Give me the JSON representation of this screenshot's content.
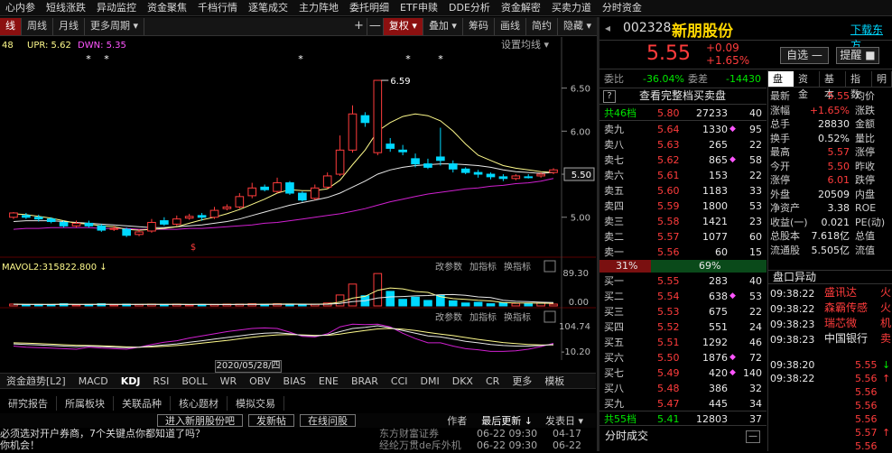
{
  "top_nav": [
    "心内参",
    "短线涨跌",
    "异动监控",
    "资金聚焦",
    "千档行情",
    "逐笔成交",
    "主力阵地",
    "委托明细",
    "ETF申赎",
    "DDE分析",
    "资金解密",
    "买卖力道",
    "分时资金"
  ],
  "toolbar": {
    "left": [
      "线",
      "周线",
      "月线",
      "更多周期 ▾"
    ],
    "icons": [
      "+",
      "—"
    ],
    "right": [
      "复权 ▾",
      "叠加 ▾",
      "筹码",
      "画线",
      "简约",
      "隐藏 ▾"
    ]
  },
  "legend": {
    "ma_value": "48",
    "upr": "UPR: 5.62",
    "dwn": "DWN: 5.35",
    "settings": "设置均线 ▾"
  },
  "price_axis": [
    "6.50",
    "6.00",
    "5.50",
    "5.00"
  ],
  "current_price_tag": "5.50",
  "annotations": {
    "high_label": "6.59",
    "dollar": "$",
    "stars": [
      "*",
      "*",
      "*",
      "*",
      "*"
    ]
  },
  "volume_panel": {
    "legend": "MAVOL2:315822.800 ↓",
    "buttons": [
      "改参数",
      "加指标",
      "换指标"
    ],
    "axis": [
      "89.30",
      "0.00"
    ]
  },
  "kdj_panel": {
    "buttons": [
      "改参数",
      "加指标",
      "换指标"
    ],
    "axis": [
      "104.74",
      "-10.20"
    ]
  },
  "date_label": "2020/05/28/四",
  "indicator_tabs": [
    "资金趋势[L2]",
    "MACD",
    "KDJ",
    "RSI",
    "BOLL",
    "WR",
    "OBV",
    "BIAS",
    "ENE",
    "BRAR",
    "CCI",
    "DMI",
    "DKX",
    "CR",
    "更多",
    "模板"
  ],
  "active_indicator": "KDJ",
  "info_tabs": [
    "研究报告",
    "所属板块",
    "关联品种",
    "核心题材",
    "模拟交易"
  ],
  "news_bar": {
    "buttons": [
      "进入新朋股份吧",
      "发新帖",
      "在线问股"
    ],
    "author": "作者",
    "latest": "最后更新 ↓",
    "posted": "发表日 ▾"
  },
  "news_items": [
    {
      "title": "必须选对开户券商，7个关键点你都知道了吗？",
      "source": "东方财富证券",
      "update": "06-22 09:30",
      "date": "04-17"
    },
    {
      "title": "你机会！",
      "source": "经纶万贯de斥外机",
      "update": "06-22 09:30",
      "date": "06-22"
    }
  ],
  "quote": {
    "code": "002328",
    "name": "新朋股份",
    "download": "下载东方",
    "price": "5.55",
    "change": "+0.09",
    "pct": "+1.65%",
    "add_self": "自选 —",
    "remind": "提醒 ■",
    "weibi_label": "委比",
    "weibi": "-36.04%",
    "weicha_label": "委差",
    "weicha": "-14430",
    "view_full": "查看完整档买卖盘",
    "total_sell_label": "共46档",
    "total_sell_price": "5.80",
    "total_sell_vol": "27233",
    "total_sell_cnt": "40",
    "total_buy_label": "共55档",
    "total_buy_price": "5.41",
    "total_buy_vol": "12803",
    "total_buy_cnt": "37",
    "ratio_sell": "31%",
    "ratio_buy": "69%",
    "tick_title": "分时成交"
  },
  "asks": [
    {
      "label": "卖九",
      "price": "5.64",
      "vol": "1330",
      "mark": "◆",
      "cnt": "95"
    },
    {
      "label": "卖八",
      "price": "5.63",
      "vol": "265",
      "mark": "",
      "cnt": "22"
    },
    {
      "label": "卖七",
      "price": "5.62",
      "vol": "865",
      "mark": "◆",
      "cnt": "58"
    },
    {
      "label": "卖六",
      "price": "5.61",
      "vol": "153",
      "mark": "",
      "cnt": "22"
    },
    {
      "label": "卖五",
      "price": "5.60",
      "vol": "1183",
      "mark": "",
      "cnt": "33"
    },
    {
      "label": "卖四",
      "price": "5.59",
      "vol": "1800",
      "mark": "",
      "cnt": "53"
    },
    {
      "label": "卖三",
      "price": "5.58",
      "vol": "1421",
      "mark": "",
      "cnt": "23"
    },
    {
      "label": "卖二",
      "price": "5.57",
      "vol": "1077",
      "mark": "",
      "cnt": "60"
    },
    {
      "label": "卖一",
      "price": "5.56",
      "vol": "60",
      "mark": "",
      "cnt": "15"
    }
  ],
  "bids": [
    {
      "label": "买一",
      "price": "5.55",
      "vol": "283",
      "mark": "",
      "cnt": "40"
    },
    {
      "label": "买二",
      "price": "5.54",
      "vol": "638",
      "mark": "◆",
      "cnt": "53"
    },
    {
      "label": "买三",
      "price": "5.53",
      "vol": "675",
      "mark": "",
      "cnt": "22"
    },
    {
      "label": "买四",
      "price": "5.52",
      "vol": "551",
      "mark": "",
      "cnt": "24"
    },
    {
      "label": "买五",
      "price": "5.51",
      "vol": "1292",
      "mark": "",
      "cnt": "46"
    },
    {
      "label": "买六",
      "price": "5.50",
      "vol": "1876",
      "mark": "◆",
      "cnt": "72"
    },
    {
      "label": "买七",
      "price": "5.49",
      "vol": "420",
      "mark": "◆",
      "cnt": "140"
    },
    {
      "label": "买八",
      "price": "5.48",
      "vol": "386",
      "mark": "",
      "cnt": "32"
    },
    {
      "label": "买九",
      "price": "5.47",
      "vol": "445",
      "mark": "",
      "cnt": "34"
    }
  ],
  "side_tabs": [
    "盘口",
    "资金",
    "基本",
    "指数",
    "明"
  ],
  "stats": [
    {
      "l": "最新",
      "v": "5.55",
      "l2": "均价"
    },
    {
      "l": "涨幅",
      "v": "+1.65%",
      "l2": "涨跌"
    },
    {
      "l": "总手",
      "v": "28830",
      "l2": "金额"
    },
    {
      "l": "换手",
      "v": "0.52%",
      "l2": "量比"
    },
    {
      "l": "最高",
      "v": "5.57",
      "l2": "涨停"
    },
    {
      "l": "今开",
      "v": "5.50",
      "l2": "昨收"
    },
    {
      "l": "涨停",
      "v": "6.01",
      "l2": "跌停"
    },
    {
      "l": "外盘",
      "v": "20509",
      "l2": "内盘"
    },
    {
      "l": "净资产",
      "v": "3.38",
      "l2": "ROE"
    },
    {
      "l": "收益(一)",
      "v": "0.021",
      "l2": "PE(动)"
    },
    {
      "l": "总股本",
      "v": "7.618亿",
      "l2": "总值"
    },
    {
      "l": "流通股",
      "v": "5.505亿",
      "l2": "流值"
    }
  ],
  "abnormal_title": "盘口异动",
  "abnormal": [
    {
      "time": "09:38:22",
      "name": "盛讯达",
      "tag": "火"
    },
    {
      "time": "09:38:22",
      "name": "森霸传感",
      "tag": "火"
    },
    {
      "time": "09:38:23",
      "name": "瑞芯微",
      "tag": "机"
    },
    {
      "time": "09:38:23",
      "name": "中国银行",
      "tag": "卖"
    }
  ],
  "ticks": [
    {
      "time": "09:38:20",
      "price": "5.55",
      "arrow": "↓"
    },
    {
      "time": "09:38:22",
      "price": "5.56",
      "arrow": "↑"
    },
    {
      "time": "",
      "price": "5.56",
      "arrow": ""
    },
    {
      "time": "",
      "price": "5.56",
      "arrow": ""
    },
    {
      "time": "",
      "price": "5.56",
      "arrow": ""
    },
    {
      "time": "",
      "price": "5.57",
      "arrow": "↑"
    },
    {
      "time": "",
      "price": "5.56",
      "arrow": ""
    }
  ],
  "colors": {
    "up": "#ff3c3c",
    "down": "#00d8ff",
    "ma5": "#fffb8c",
    "ma10": "#e8e8e8",
    "ma20": "#d020d0",
    "bg": "#000000"
  },
  "chart_data": {
    "type": "candlestick",
    "y_axis_ticks": [
      6.5,
      6.0,
      5.5,
      5.0
    ],
    "candles": [
      [
        5.0,
        5.05,
        5.06,
        4.98
      ],
      [
        5.02,
        5.0,
        5.05,
        4.98
      ],
      [
        5.0,
        4.98,
        5.03,
        4.95
      ],
      [
        4.98,
        4.95,
        5.0,
        4.93
      ],
      [
        4.94,
        4.9,
        4.96,
        4.88
      ],
      [
        4.9,
        4.93,
        4.96,
        4.88
      ],
      [
        4.93,
        4.9,
        4.96,
        4.88
      ],
      [
        4.9,
        4.85,
        4.92,
        4.83
      ],
      [
        4.86,
        4.87,
        4.9,
        4.84
      ],
      [
        4.86,
        4.79,
        4.88,
        4.77
      ],
      [
        4.8,
        4.83,
        4.86,
        4.78
      ],
      [
        4.84,
        4.94,
        4.98,
        4.82
      ],
      [
        4.96,
        4.92,
        5.0,
        4.9
      ],
      [
        4.92,
        4.98,
        5.02,
        4.9
      ],
      [
        4.99,
        5.01,
        5.04,
        4.97
      ],
      [
        5.02,
        5.0,
        5.05,
        4.96
      ],
      [
        5.0,
        5.08,
        5.12,
        4.98
      ],
      [
        5.1,
        5.12,
        5.15,
        5.08
      ],
      [
        5.12,
        5.24,
        5.28,
        5.1
      ],
      [
        5.25,
        5.34,
        5.4,
        5.22
      ],
      [
        5.35,
        5.32,
        5.38,
        5.3
      ],
      [
        5.3,
        5.4,
        5.46,
        5.28
      ],
      [
        5.4,
        5.28,
        5.42,
        5.26
      ],
      [
        5.28,
        5.2,
        5.3,
        5.18
      ],
      [
        5.22,
        5.34,
        5.38,
        5.2
      ],
      [
        5.35,
        5.48,
        5.52,
        5.33
      ],
      [
        5.5,
        5.78,
        5.95,
        5.48
      ],
      [
        5.78,
        6.2,
        6.3,
        5.75
      ],
      [
        6.18,
        6.1,
        6.22,
        6.05
      ],
      [
        5.75,
        6.59,
        6.59,
        5.72
      ],
      [
        5.85,
        5.8,
        5.92,
        5.76
      ],
      [
        5.78,
        5.76,
        5.84,
        5.72
      ],
      [
        5.68,
        5.62,
        5.74,
        5.58
      ],
      [
        5.62,
        5.58,
        5.68,
        5.56
      ],
      [
        5.7,
        5.66,
        6.04,
        5.6
      ],
      [
        5.62,
        5.56,
        5.66,
        5.52
      ],
      [
        5.56,
        5.52,
        5.58,
        5.5
      ],
      [
        5.52,
        5.5,
        5.55,
        5.46
      ],
      [
        5.5,
        5.47,
        5.52,
        5.44
      ],
      [
        5.47,
        5.45,
        5.5,
        5.42
      ],
      [
        5.45,
        5.48,
        5.5,
        5.43
      ],
      [
        5.47,
        5.46,
        5.5,
        5.45
      ],
      [
        5.48,
        5.5,
        5.52,
        5.46
      ],
      [
        5.52,
        5.55,
        5.57,
        5.5
      ]
    ],
    "ma5": [
      5.04,
      5.03,
      5.01,
      4.99,
      4.96,
      4.93,
      4.92,
      4.9,
      4.89,
      4.86,
      4.85,
      4.86,
      4.87,
      4.89,
      4.93,
      4.97,
      5.0,
      5.04,
      5.09,
      5.15,
      5.21,
      5.28,
      5.32,
      5.31,
      5.31,
      5.33,
      5.43,
      5.61,
      5.78,
      6.0,
      6.1,
      6.17,
      6.2,
      6.18,
      6.12,
      6.0,
      5.85,
      5.72,
      5.66,
      5.6,
      5.57,
      5.55,
      5.53,
      5.52
    ],
    "ma10": [
      4.95,
      4.96,
      4.96,
      4.96,
      4.95,
      4.94,
      4.93,
      4.92,
      4.91,
      4.9,
      4.89,
      4.88,
      4.88,
      4.89,
      4.9,
      4.91,
      4.93,
      4.95,
      4.98,
      5.02,
      5.06,
      5.1,
      5.14,
      5.17,
      5.2,
      5.23,
      5.28,
      5.35,
      5.42,
      5.5,
      5.55,
      5.58,
      5.6,
      5.61,
      5.62,
      5.62,
      5.61,
      5.6,
      5.58,
      5.55,
      5.53,
      5.52,
      5.51,
      5.52
    ],
    "ma20": [
      4.86,
      4.87,
      4.87,
      4.88,
      4.88,
      4.88,
      4.88,
      4.87,
      4.87,
      4.87,
      4.86,
      4.86,
      4.86,
      4.86,
      4.87,
      4.87,
      4.88,
      4.89,
      4.9,
      4.91,
      4.93,
      4.94,
      4.96,
      4.98,
      5.0,
      5.02,
      5.04,
      5.07,
      5.1,
      5.14,
      5.18,
      5.21,
      5.24,
      5.27,
      5.29,
      5.31,
      5.33,
      5.34,
      5.36,
      5.37,
      5.39,
      5.4,
      5.42,
      5.45
    ],
    "volume": {
      "values": [
        5,
        4,
        4,
        4,
        6,
        3,
        4,
        6,
        3,
        5,
        4,
        5,
        4,
        5,
        3,
        4,
        4,
        5,
        5,
        6,
        4,
        6,
        5,
        4,
        5,
        8,
        30,
        60,
        28,
        89,
        40,
        18,
        24,
        15,
        30,
        14,
        8,
        10,
        6,
        9,
        7,
        7,
        8,
        5
      ],
      "max": 89.3
    },
    "kdj": {
      "k": [
        30,
        28,
        26,
        24,
        22,
        20,
        22,
        20,
        18,
        16,
        18,
        22,
        26,
        30,
        36,
        42,
        48,
        54,
        60,
        66,
        70,
        72,
        68,
        62,
        60,
        64,
        76,
        88,
        92,
        98,
        90,
        80,
        70,
        60,
        56,
        48,
        40,
        34,
        28,
        24,
        22,
        22,
        24,
        28
      ],
      "d": [
        34,
        33,
        31,
        29,
        27,
        25,
        24,
        23,
        21,
        19,
        18,
        19,
        21,
        24,
        28,
        33,
        38,
        43,
        49,
        55,
        60,
        64,
        65,
        64,
        62,
        62,
        67,
        74,
        80,
        86,
        88,
        85,
        80,
        73,
        67,
        61,
        54,
        47,
        41,
        35,
        31,
        28,
        26,
        26
      ],
      "j": [
        22,
        18,
        16,
        14,
        12,
        10,
        18,
        14,
        12,
        10,
        18,
        28,
        36,
        42,
        52,
        60,
        68,
        76,
        82,
        88,
        90,
        88,
        74,
        58,
        56,
        68,
        94,
        104,
        102,
        104,
        94,
        70,
        50,
        34,
        34,
        22,
        12,
        8,
        2,
        2,
        4,
        10,
        20,
        32
      ],
      "range": [
        -10.2,
        104.74
      ]
    }
  }
}
